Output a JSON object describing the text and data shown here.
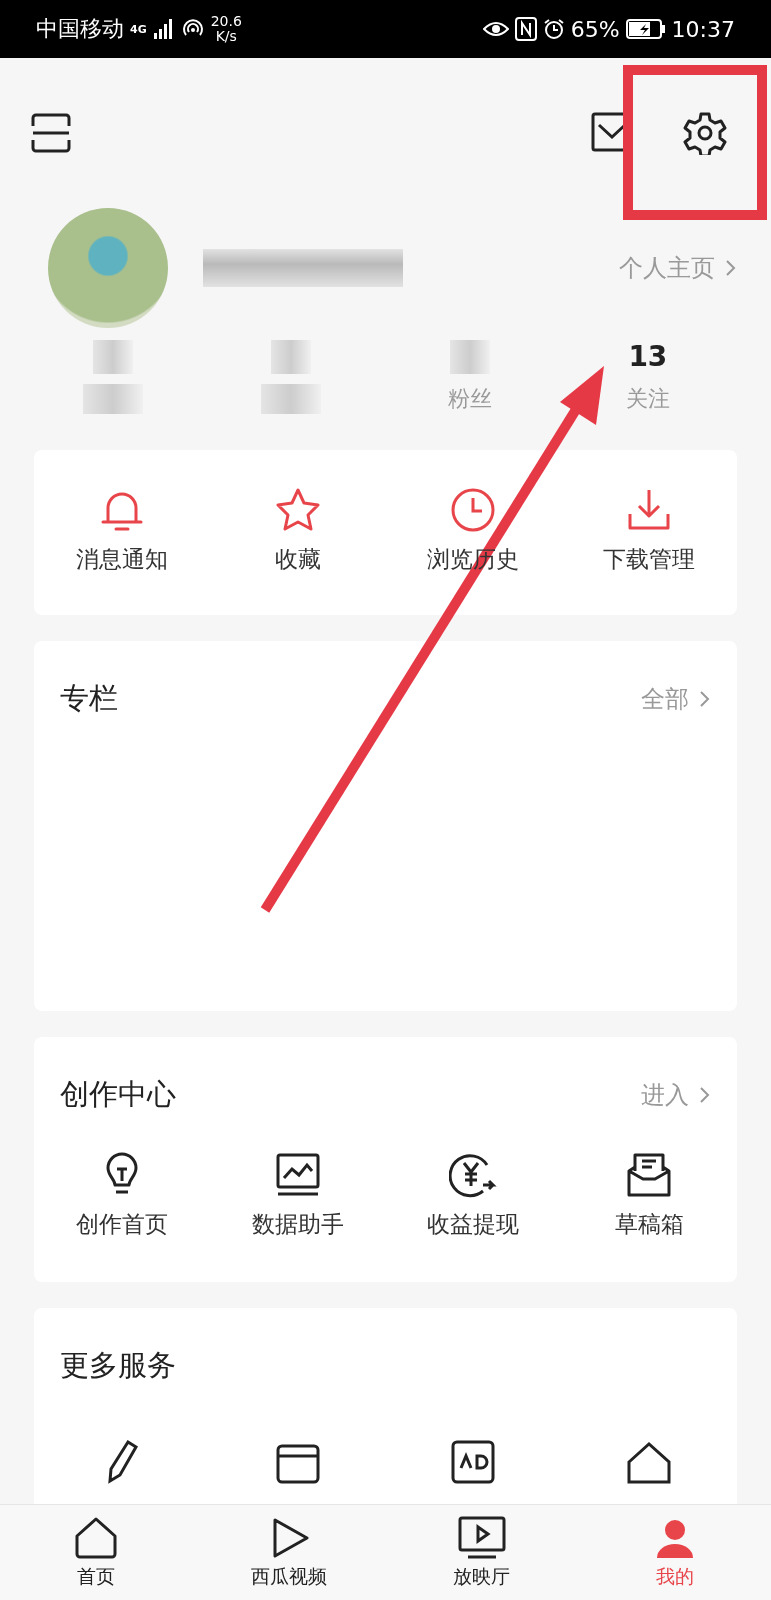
{
  "status_bar": {
    "carrier": "中国移动",
    "network": "4G",
    "speed_value": "20.6",
    "speed_unit": "K/s",
    "battery": "65%",
    "time": "10:37"
  },
  "profile": {
    "homepage_link": "个人主页",
    "stats": [
      {
        "label": "粉丝"
      },
      {
        "value": "13",
        "label": "关注"
      }
    ]
  },
  "quick_actions": [
    {
      "label": "消息通知"
    },
    {
      "label": "收藏"
    },
    {
      "label": "浏览历史"
    },
    {
      "label": "下载管理"
    }
  ],
  "column_section": {
    "title": "专栏",
    "link": "全部"
  },
  "creator_center": {
    "title": "创作中心",
    "link": "进入",
    "items": [
      {
        "label": "创作首页"
      },
      {
        "label": "数据助手"
      },
      {
        "label": "收益提现"
      },
      {
        "label": "草稿箱"
      }
    ]
  },
  "more_services": {
    "title": "更多服务"
  },
  "tabs": [
    {
      "label": "首页",
      "selected": false
    },
    {
      "label": "西瓜视频",
      "selected": false
    },
    {
      "label": "放映厅",
      "selected": false
    },
    {
      "label": "我的",
      "selected": true
    }
  ]
}
